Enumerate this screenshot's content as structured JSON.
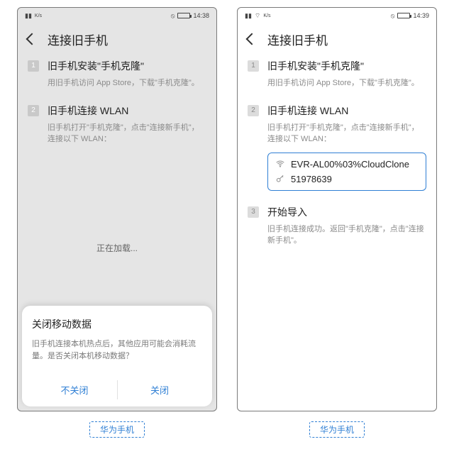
{
  "device_captions": {
    "left": "华为手机",
    "right": "华为手机"
  },
  "left_phone": {
    "status": {
      "time": "14:38",
      "net_small": "K/s"
    },
    "nav": {
      "title": "连接旧手机"
    },
    "steps": [
      {
        "num": "1",
        "title": "旧手机安装\"手机克隆\"",
        "desc": "用旧手机访问 App Store，下载\"手机克隆\"。"
      },
      {
        "num": "2",
        "title": "旧手机连接 WLAN",
        "desc": "旧手机打开\"手机克隆\"，点击\"连接新手机\"，连接以下 WLAN："
      }
    ],
    "loading": "正在加载...",
    "dialog": {
      "title": "关闭移动数据",
      "body": "旧手机连接本机热点后，其他应用可能会消耗流量。是否关闭本机移动数据？",
      "cancel": "不关闭",
      "confirm": "关闭"
    }
  },
  "right_phone": {
    "status": {
      "time": "14:39",
      "net_small": "K/s"
    },
    "nav": {
      "title": "连接旧手机"
    },
    "steps": [
      {
        "num": "1",
        "title": "旧手机安装\"手机克隆\"",
        "desc": "用旧手机访问 App Store，下载\"手机克隆\"。"
      },
      {
        "num": "2",
        "title": "旧手机连接 WLAN",
        "desc": "旧手机打开\"手机克隆\"，点击\"连接新手机\"，连接以下 WLAN：",
        "wifi": {
          "ssid": "EVR-AL00%03%CloudClone",
          "password": "51978639"
        }
      },
      {
        "num": "3",
        "title": "开始导入",
        "desc": "旧手机连接成功。返回\"手机克隆\"，点击\"连接新手机\"。"
      }
    ]
  }
}
